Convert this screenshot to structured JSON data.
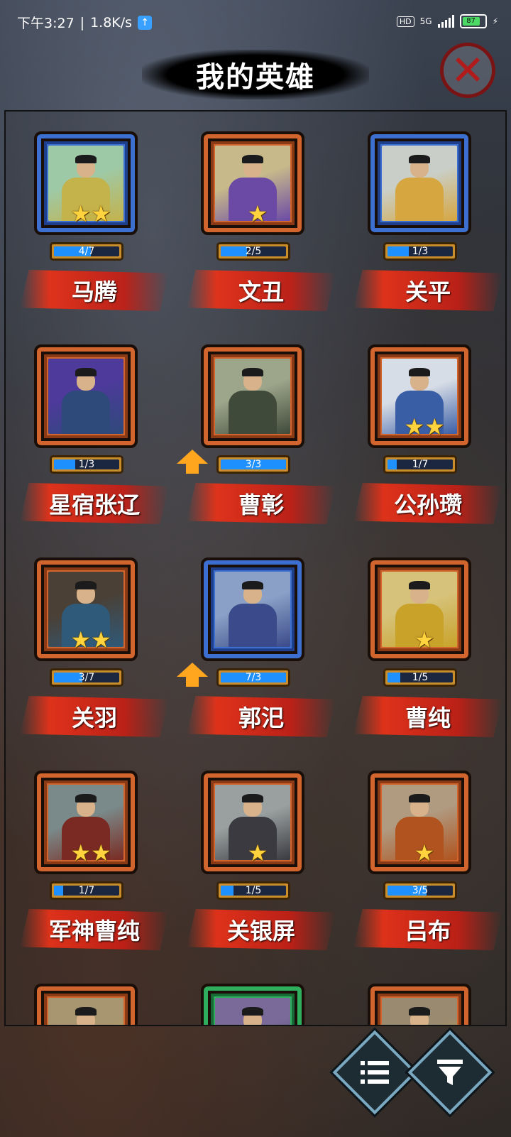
{
  "status_bar": {
    "time": "下午3:27",
    "separator": "|",
    "net_speed": "1.8K/s",
    "hd": "HD",
    "network": "5G",
    "battery": "87"
  },
  "title": "我的英雄",
  "colors": {
    "frame_blue": "#3d6fd0",
    "frame_orange": "#d1652d",
    "frame_green": "#2fae5d",
    "progress_fill": "#1e90ff",
    "name_strip": "#e5321c",
    "star": "#ffd33d"
  },
  "icons": {
    "close": "close-x-icon",
    "list": "list-icon",
    "filter": "filter-funnel-icon",
    "upgrade": "upgrade-arrow-icon",
    "star": "star-icon"
  },
  "heroes": [
    {
      "name": "马腾",
      "progress": "4/7",
      "fill": 0.57,
      "stars": 2,
      "frame": "blue",
      "upgrade": false,
      "palette": [
        "#9ec9a6",
        "#c4b24a"
      ]
    },
    {
      "name": "文丑",
      "progress": "2/5",
      "fill": 0.4,
      "stars": 1,
      "frame": "orange",
      "upgrade": false,
      "palette": [
        "#c7b98a",
        "#6b4aa6"
      ]
    },
    {
      "name": "关平",
      "progress": "1/3",
      "fill": 0.33,
      "stars": 0,
      "frame": "blue",
      "upgrade": false,
      "palette": [
        "#c9cfc8",
        "#d6a640"
      ]
    },
    {
      "name": "星宿张辽",
      "progress": "1/3",
      "fill": 0.33,
      "stars": 0,
      "frame": "orange",
      "upgrade": false,
      "palette": [
        "#4d3a9a",
        "#2e4a7a"
      ]
    },
    {
      "name": "曹彰",
      "progress": "3/3",
      "fill": 1.0,
      "stars": 0,
      "frame": "orange",
      "upgrade": true,
      "palette": [
        "#9da58a",
        "#3f4a3a"
      ]
    },
    {
      "name": "公孙瓒",
      "progress": "1/7",
      "fill": 0.14,
      "stars": 2,
      "frame": "orange",
      "upgrade": false,
      "palette": [
        "#d7dde6",
        "#3a5ea6"
      ]
    },
    {
      "name": "关羽",
      "progress": "3/7",
      "fill": 0.43,
      "stars": 2,
      "frame": "orange",
      "upgrade": false,
      "palette": [
        "#4a4036",
        "#2f5a7a"
      ]
    },
    {
      "name": "郭汜",
      "progress": "7/3",
      "fill": 1.0,
      "stars": 0,
      "frame": "blue",
      "upgrade": true,
      "palette": [
        "#8aa0c6",
        "#3a4a8a"
      ]
    },
    {
      "name": "曹纯",
      "progress": "1/5",
      "fill": 0.2,
      "stars": 1,
      "frame": "orange",
      "upgrade": false,
      "palette": [
        "#d6c27a",
        "#c9a22a"
      ]
    },
    {
      "name": "军神曹纯",
      "progress": "1/7",
      "fill": 0.14,
      "stars": 2,
      "frame": "orange",
      "upgrade": false,
      "palette": [
        "#7a8a8a",
        "#7a2a22"
      ]
    },
    {
      "name": "关银屏",
      "progress": "1/5",
      "fill": 0.2,
      "stars": 1,
      "frame": "orange",
      "upgrade": false,
      "palette": [
        "#9aa0a0",
        "#3a3a40"
      ]
    },
    {
      "name": "吕布",
      "progress": "3/5",
      "fill": 0.6,
      "stars": 1,
      "frame": "orange",
      "upgrade": false,
      "palette": [
        "#b09a80",
        "#b0531e"
      ]
    },
    {
      "name": "",
      "progress": "",
      "fill": 0,
      "stars": 0,
      "frame": "orange",
      "upgrade": false,
      "palette": [
        "#a89670",
        "#c9a22a"
      ]
    },
    {
      "name": "",
      "progress": "",
      "fill": 0,
      "stars": 0,
      "frame": "green",
      "upgrade": false,
      "palette": [
        "#7a6a9a",
        "#3a3a5a"
      ]
    },
    {
      "name": "",
      "progress": "",
      "fill": 0,
      "stars": 0,
      "frame": "orange",
      "upgrade": false,
      "palette": [
        "#9a8a70",
        "#c9a22a"
      ]
    }
  ]
}
